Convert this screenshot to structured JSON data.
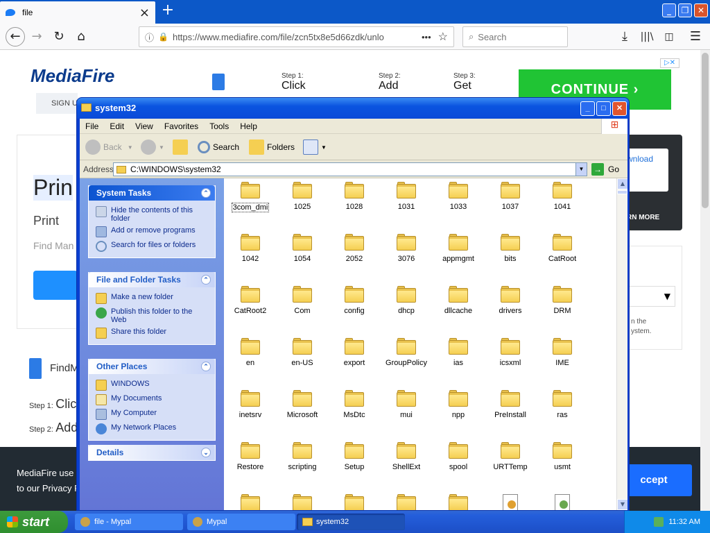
{
  "browser": {
    "tab_title": "file",
    "tab_close": "×",
    "new_tab": "+",
    "url": "https://www.mediafire.com/file/zcn5tx8e5d66zdk/unlo",
    "url_menu": "•••",
    "search_placeholder": "Search"
  },
  "page": {
    "logo": "MediaFire",
    "signup": "SIGN U",
    "ad": {
      "step1_label": "Step 1:",
      "step1": "Click",
      "step2_label": "Step 2:",
      "step2": "Add",
      "step3_label": "Step 3:",
      "step3": "Get",
      "continue": "CONTINUE  ›"
    },
    "left_text": {
      "big": "Prin",
      "sub": "Print",
      "find": "Find Man"
    },
    "right_text": {
      "download": "wnload",
      "learn_more": "RN MORE",
      "the": "n the",
      "system": "ystem."
    },
    "findm": "FindM",
    "steps_lower": [
      {
        "label": "Step 1:",
        "text": "Clic"
      },
      {
        "label": "Step 2:",
        "text": "Add"
      }
    ],
    "cookie": {
      "line1": "MediaFire use",
      "line2": "to our Privacy P",
      "accept": "ccept"
    }
  },
  "explorer": {
    "title": "system32",
    "menu": [
      "File",
      "Edit",
      "View",
      "Favorites",
      "Tools",
      "Help"
    ],
    "toolbar": {
      "back": "Back",
      "search": "Search",
      "folders": "Folders"
    },
    "address_label": "Address",
    "address": "C:\\WINDOWS\\system32",
    "go": "Go",
    "system_tasks": {
      "header": "System Tasks",
      "items": [
        "Hide the contents of this folder",
        "Add or remove programs",
        "Search for files or folders"
      ]
    },
    "file_tasks": {
      "header": "File and Folder Tasks",
      "items": [
        "Make a new folder",
        "Publish this folder to the Web",
        "Share this folder"
      ]
    },
    "other_places": {
      "header": "Other Places",
      "items": [
        "WINDOWS",
        "My Documents",
        "My Computer",
        "My Network Places"
      ]
    },
    "details": {
      "header": "Details"
    },
    "files": [
      [
        "3com_dmi",
        "1025",
        "1028",
        "1031",
        "1033",
        "1037",
        "1041"
      ],
      [
        "1042",
        "1054",
        "2052",
        "3076",
        "appmgmt",
        "bits",
        "CatRoot"
      ],
      [
        "CatRoot2",
        "Com",
        "config",
        "dhcp",
        "dllcache",
        "drivers",
        "DRM"
      ],
      [
        "en",
        "en-US",
        "export",
        "GroupPolicy",
        "ias",
        "icsxml",
        "IME"
      ],
      [
        "inetsrv",
        "Microsoft",
        "MsDtc",
        "mui",
        "npp",
        "PreInstall",
        "ras"
      ],
      [
        "Restore",
        "scripting",
        "Setup",
        "ShellExt",
        "spool",
        "URTTemp",
        "usmt"
      ]
    ]
  },
  "taskbar": {
    "start": "start",
    "tasks": [
      "file - Mypal",
      "Mypal",
      "system32"
    ],
    "clock": "11:32 AM"
  }
}
